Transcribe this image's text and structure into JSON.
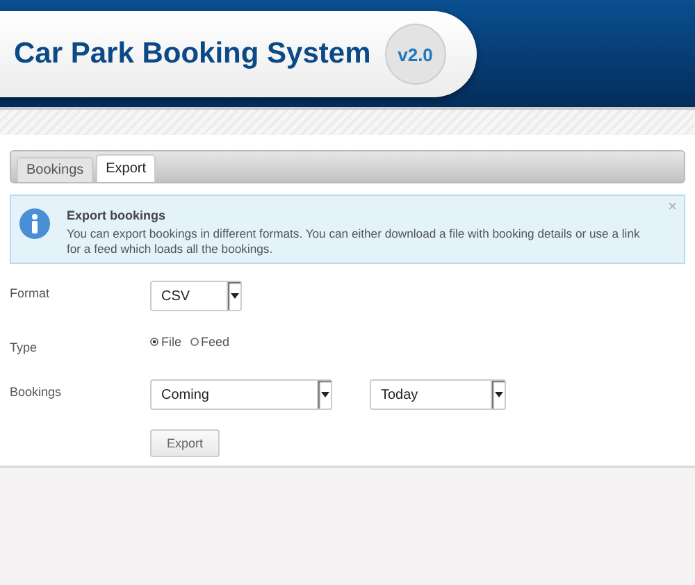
{
  "header": {
    "title": "Car Park Booking System",
    "version": "v2.0"
  },
  "tabs": [
    {
      "label": "Bookings",
      "selected": false
    },
    {
      "label": "Export",
      "selected": true
    }
  ],
  "info": {
    "title": "Export bookings",
    "text": "You can export bookings in different formats. You can either download a file with booking details or use a link for a feed which loads all the bookings.",
    "close": "×"
  },
  "form": {
    "format": {
      "label": "Format",
      "value": "CSV"
    },
    "type": {
      "label": "Type",
      "options": [
        {
          "label": "File",
          "selected": true
        },
        {
          "label": "Feed",
          "selected": false
        }
      ]
    },
    "bookings": {
      "label": "Bookings",
      "period": "Coming",
      "range": "Today"
    },
    "button": "Export"
  }
}
